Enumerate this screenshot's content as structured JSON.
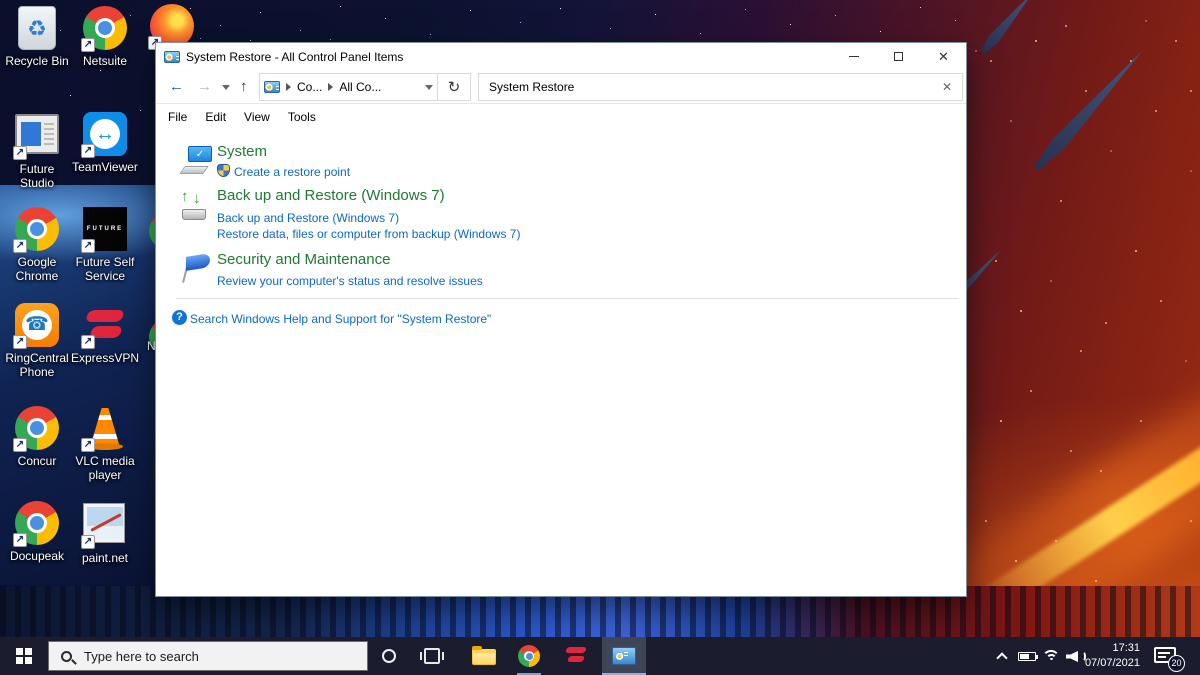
{
  "desktop": {
    "icons": [
      {
        "label": "Recycle Bin"
      },
      {
        "label": "Netsuite"
      },
      {
        "label": "Future Studio"
      },
      {
        "label": "TeamViewer"
      },
      {
        "label": "Google Chrome"
      },
      {
        "label": "Future Self Service"
      },
      {
        "label": "RingCentral Phone"
      },
      {
        "label": "ExpressVPN"
      },
      {
        "label": "Concur"
      },
      {
        "label": "VLC media player"
      },
      {
        "label": "Docupeak"
      },
      {
        "label": "paint.net"
      }
    ],
    "partial_label": "N"
  },
  "icons": {
    "recycle": "♻",
    "tv_arrows": "↔",
    "phone": "☎",
    "shortcut_arrow": "↗",
    "future_text": "FUTURE",
    "back_arrow": "←",
    "forward_arrow": "→",
    "up_arrow": "↑",
    "refresh": "↻",
    "close_x": "✕",
    "clear_x": "✕",
    "check": "✓",
    "help_q": "?",
    "arrow_up_small": "↑",
    "arrow_down_small": "↓"
  },
  "window": {
    "title": "System Restore - All Control Panel Items",
    "nav": {
      "crumb1": "Co...",
      "crumb2": "All Co...",
      "search_value": "System Restore"
    },
    "menu": [
      "File",
      "Edit",
      "View",
      "Tools"
    ],
    "results": [
      {
        "heading": "System",
        "links": [
          {
            "text": "Create a restore point"
          }
        ]
      },
      {
        "heading": "Back up and Restore (Windows 7)",
        "links": [
          {
            "text": "Back up and Restore (Windows 7)"
          },
          {
            "text": "Restore data, files or computer from backup (Windows 7)"
          }
        ]
      },
      {
        "heading": "Security and Maintenance",
        "links": [
          {
            "text": "Review your computer's status and resolve issues"
          }
        ]
      }
    ],
    "help_link": "Search Windows Help and Support for \"System Restore\""
  },
  "taskbar": {
    "search_placeholder": "Type here to search",
    "time": "17:31",
    "date": "07/07/2021",
    "badge": "20"
  },
  "colors": {
    "heading_green": "#1e7a34",
    "link_blue": "#0b69c7",
    "taskbar_bg": "#1b1d2e",
    "active_underline": "#76b9ed"
  }
}
